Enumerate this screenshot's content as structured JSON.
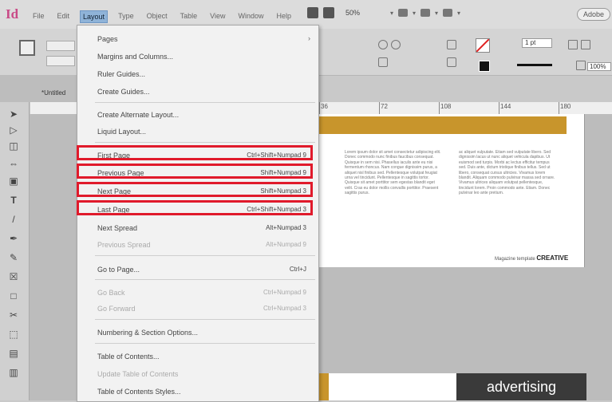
{
  "app": {
    "logo": "Id",
    "adobe_button": "Adobe"
  },
  "menubar": {
    "items": [
      {
        "label": "File",
        "active": false
      },
      {
        "label": "Edit",
        "active": false
      },
      {
        "label": "Layout",
        "active": true
      },
      {
        "label": "Type",
        "active": false
      },
      {
        "label": "Object",
        "active": false
      },
      {
        "label": "Table",
        "active": false
      },
      {
        "label": "View",
        "active": false
      },
      {
        "label": "Window",
        "active": false
      },
      {
        "label": "Help",
        "active": false
      }
    ],
    "zoom": "50%"
  },
  "controlbar": {
    "stroke_weight": "1 pt",
    "opacity": "100%"
  },
  "document_tab": "*Untitled",
  "ruler": {
    "labels": [
      "36",
      "72",
      "108",
      "144",
      "180"
    ]
  },
  "layout_menu": {
    "items": [
      {
        "label": "Pages",
        "shortcut": "",
        "submenu": true,
        "disabled": false
      },
      {
        "label": "Margins and Columns...",
        "shortcut": "",
        "disabled": false
      },
      {
        "label": "Ruler Guides...",
        "shortcut": "",
        "disabled": false
      },
      {
        "label": "Create Guides...",
        "shortcut": "",
        "disabled": false
      },
      {
        "label": "Create Alternate Layout...",
        "shortcut": "",
        "disabled": false
      },
      {
        "label": "Liquid Layout...",
        "shortcut": "",
        "disabled": false
      },
      {
        "label": "First Page",
        "shortcut": "Ctrl+Shift+Numpad 9",
        "disabled": false,
        "highlighted": true
      },
      {
        "label": "Previous Page",
        "shortcut": "Shift+Numpad 9",
        "disabled": false,
        "highlighted": true
      },
      {
        "label": "Next Page",
        "shortcut": "Shift+Numpad 3",
        "disabled": false,
        "highlighted": true
      },
      {
        "label": "Last Page",
        "shortcut": "Ctrl+Shift+Numpad 3",
        "disabled": false,
        "highlighted": true
      },
      {
        "label": "Next Spread",
        "shortcut": "Alt+Numpad 3",
        "disabled": false
      },
      {
        "label": "Previous Spread",
        "shortcut": "Alt+Numpad 9",
        "disabled": true
      },
      {
        "label": "Go to Page...",
        "shortcut": "Ctrl+J",
        "disabled": false
      },
      {
        "label": "Go Back",
        "shortcut": "Ctrl+Numpad 9",
        "disabled": true
      },
      {
        "label": "Go Forward",
        "shortcut": "Ctrl+Numpad 3",
        "disabled": true
      },
      {
        "label": "Numbering & Section Options...",
        "shortcut": "",
        "disabled": false
      },
      {
        "label": "Table of Contents...",
        "shortcut": "",
        "disabled": false
      },
      {
        "label": "Update Table of Contents",
        "shortcut": "",
        "disabled": true
      },
      {
        "label": "Table of Contents Styles...",
        "shortcut": "",
        "disabled": false
      }
    ]
  },
  "document": {
    "column1": "Lorem ipsum dolor sit amet consectetur adipiscing elit. Donec commodo nunc finibus faucibus consequat. Quisque in sem nisi. Phasellus iaculis ante eu nisi fermentum rhoncus. Nam congue dignissim purus, a aliquet nisl finibus sed. Pellentesque volutpat feugiat urna vel tincidunt. Pellentesque in sagittis tortor. Quisque sit amet porttitor sem egestas blandit eget velit. Cras eu dolor mollis convallis porttitor. Praesent sagittis purus.",
    "column2": "ac aliquet vulputate. Etiam sed vulputate libero. Sed dignissim lacus ut nunc aliquet vehicula dapibus. Ut euismod sed turpis. Morbi ac lectus efficitur tempus sed. Duis ante, dictum tristique finibus tellus. Sed ut libero, consequat cursus ultricies. Vivamus lorem blandit. Aliquam commodo pulvinar massa sed ornare. Vivamus ultrices aliquam volutpat pellentesque, tincidunt lorem. Proin commodo ante. Etiam. Donec pulvinar leo ante pretium.",
    "caption_prefix": "Magazine template",
    "caption_brand": "CREATIVE",
    "advertising": "advertising"
  }
}
